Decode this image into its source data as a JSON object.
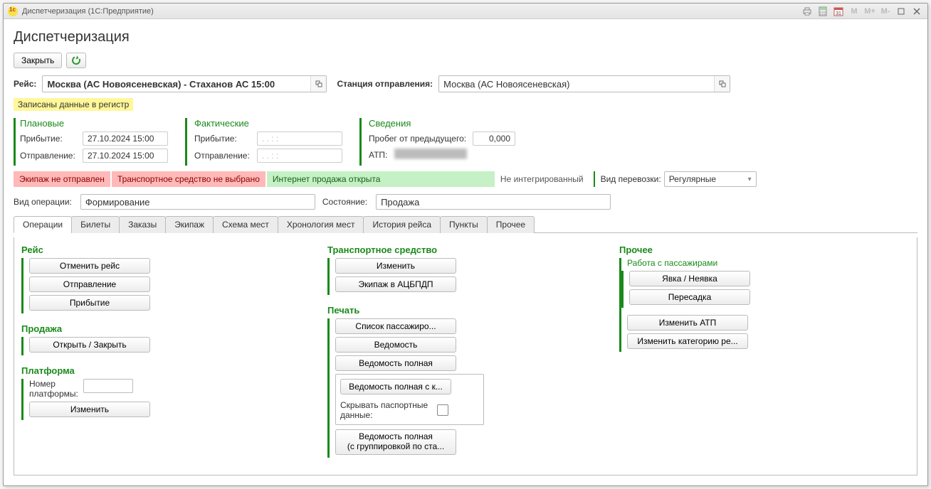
{
  "window": {
    "title": "Диспетчеризация  (1С:Предприятие)"
  },
  "titlebar_tools": {
    "m": "M",
    "mplus": "M+",
    "mminus": "M-"
  },
  "page_title": "Диспетчеризация",
  "toolbar": {
    "close": "Закрыть"
  },
  "route": {
    "label": "Рейс:",
    "value": "Москва (АС Новоясеневская) - Стаханов АС 15:00",
    "station_label": "Станция отправления:",
    "station_value": "Москва (АС Новоясеневская)"
  },
  "highlight": "Записаны данные в регистр",
  "planned": {
    "title": "Плановые",
    "arrival_label": "Прибытие:",
    "arrival_value": "27.10.2024 15:00",
    "departure_label": "Отправление:",
    "departure_value": "27.10.2024 15:00"
  },
  "actual": {
    "title": "Фактические",
    "arrival_label": "Прибытие:",
    "arrival_value": "  .  .        :  :",
    "departure_label": "Отправление:",
    "departure_value": "  .  .        :  :"
  },
  "info": {
    "title": "Сведения",
    "mileage_label": "Пробег от предыдущего:",
    "mileage_value": "0,000",
    "atp_label": "АТП:"
  },
  "status": {
    "crew_not_sent": "Экипаж не отправлен",
    "vehicle_not_selected": "Транспортное средство не выбрано",
    "internet_open": "Интернет продажа открыта",
    "not_integrated": "Не интегрированный",
    "transport_type_label": "Вид перевозки:",
    "transport_type_value": "Регулярные"
  },
  "ops": {
    "op_label": "Вид операции:",
    "op_value": "Формирование",
    "state_label": "Состояние:",
    "state_value": "Продажа"
  },
  "tabs": [
    "Операции",
    "Билеты",
    "Заказы",
    "Экипаж",
    "Схема мест",
    "Хронология мест",
    "История рейса",
    "Пункты",
    "Прочее"
  ],
  "groups": {
    "trip": {
      "title": "Рейс",
      "cancel": "Отменить рейс",
      "departure": "Отправление",
      "arrival": "Прибытие"
    },
    "sales": {
      "title": "Продажа",
      "toggle": "Открыть / Закрыть"
    },
    "platform": {
      "title": "Платформа",
      "number_label": "Номер платформы:",
      "change": "Изменить"
    },
    "vehicle": {
      "title": "Транспортное средство",
      "change": "Изменить",
      "crew": "Экипаж в АЦБПДП"
    },
    "print": {
      "title": "Печать",
      "pass_list": "Список пассажиро...",
      "sheet": "Ведомость",
      "sheet_full": "Ведомость полная",
      "sheet_full_k": "Ведомость полная с к...",
      "hide_passport": "Скрывать паспортные данные:",
      "sheet_full_group_l1": "Ведомость полная",
      "sheet_full_group_l2": "(с группировкой по ста..."
    },
    "other": {
      "title": "Прочее",
      "passengers_title": "Работа с пассажирами",
      "attendance": "Явка / Неявка",
      "transfer": "Пересадка",
      "change_atp": "Изменить АТП",
      "change_category": "Изменить категорию ре..."
    }
  }
}
